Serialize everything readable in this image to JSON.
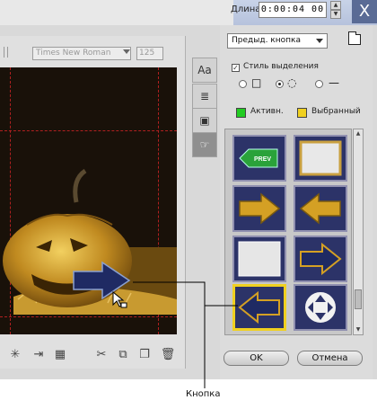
{
  "header": {
    "duration_label": "Длина:",
    "duration_value": "0:00:04 00",
    "close_glyph": "X"
  },
  "text_toolbar": {
    "font_value": "Times New Roman",
    "size_value": "125"
  },
  "side_buttons": [
    {
      "icon": "text-style-icon",
      "glyph": "Aa"
    },
    {
      "icon": "text-align-icon",
      "glyph": "≣"
    },
    {
      "icon": "image-icon",
      "glyph": "▣"
    },
    {
      "icon": "button-tool-icon",
      "glyph": "☞"
    }
  ],
  "right_panel": {
    "preset_select": "Предыд. кнопка",
    "style_checkbox_label": "Стиль выделения",
    "style_checked": true,
    "shape_options": [
      "rectangle",
      "circle",
      "freeform",
      "line"
    ],
    "selected_shape": "circle",
    "color_active_label": "Активн.",
    "color_active": "#22cc22",
    "color_selected_label": "Выбранный",
    "color_selected": "#f0d020",
    "ok_label": "OK",
    "cancel_label": "Отмена"
  },
  "gallery_tiles": [
    {
      "name": "prev-button-tile",
      "text": "PREV"
    },
    {
      "name": "blank-frame-tile"
    },
    {
      "name": "arrow-right-tile"
    },
    {
      "name": "arrow-left-tile"
    },
    {
      "name": "blank-square-tile"
    },
    {
      "name": "arrow-right-dark-tile"
    },
    {
      "name": "arrow-left-selected-tile"
    },
    {
      "name": "round-button-tile"
    }
  ],
  "callout": {
    "label": "Кнопка"
  },
  "colors": {
    "canvas_bg": "#191109",
    "tile_bg": "#2c3368",
    "arrow_gold": "#d4a024",
    "arrow_navy": "#1f2a63",
    "selection_yellow": "#f0d020"
  }
}
